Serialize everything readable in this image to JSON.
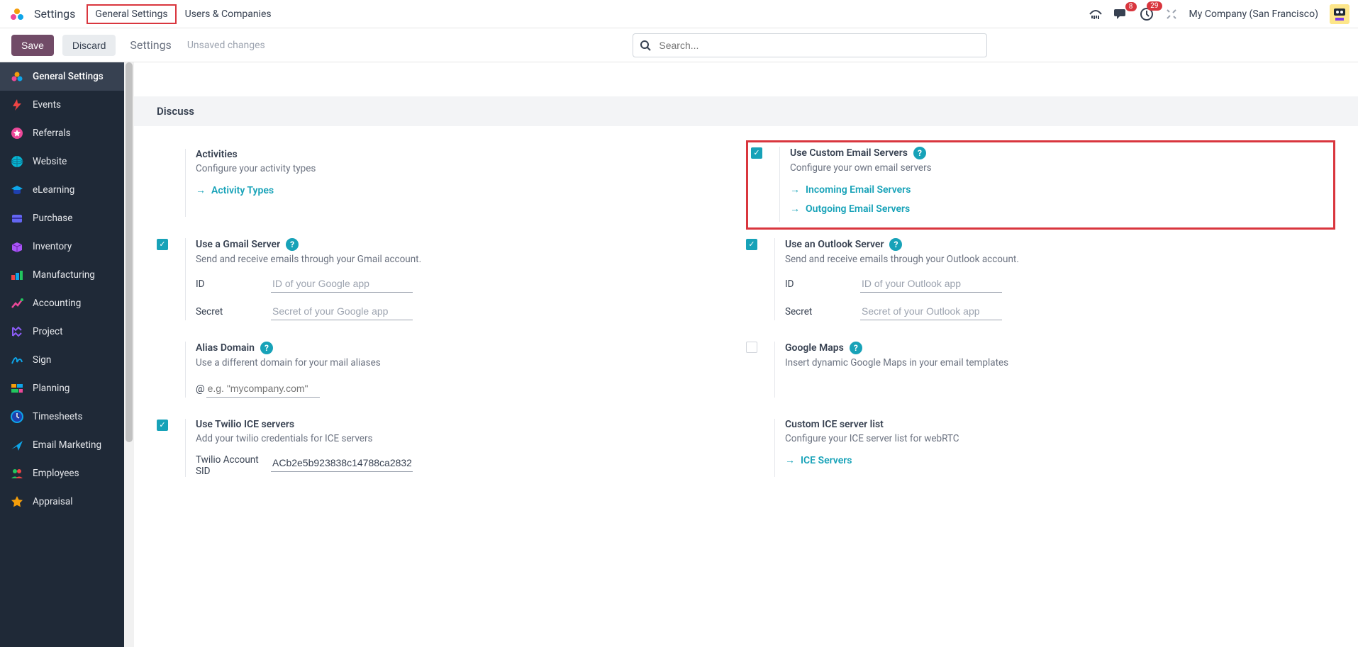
{
  "topnav": {
    "app_title": "Settings",
    "tab_general": "General Settings",
    "tab_users": "Users & Companies",
    "messages_badge": "8",
    "activities_badge": "29",
    "company_name": "My Company (San Francisco)"
  },
  "controlpanel": {
    "save": "Save",
    "discard": "Discard",
    "title": "Settings",
    "status": "Unsaved changes",
    "search_placeholder": "Search..."
  },
  "sidebar": {
    "items": [
      {
        "label": "General Settings"
      },
      {
        "label": "Events"
      },
      {
        "label": "Referrals"
      },
      {
        "label": "Website"
      },
      {
        "label": "eLearning"
      },
      {
        "label": "Purchase"
      },
      {
        "label": "Inventory"
      },
      {
        "label": "Manufacturing"
      },
      {
        "label": "Accounting"
      },
      {
        "label": "Project"
      },
      {
        "label": "Sign"
      },
      {
        "label": "Planning"
      },
      {
        "label": "Timesheets"
      },
      {
        "label": "Email Marketing"
      },
      {
        "label": "Employees"
      },
      {
        "label": "Appraisal"
      }
    ]
  },
  "settings": {
    "section_header": "Discuss",
    "activities": {
      "title": "Activities",
      "desc": "Configure your activity types",
      "link": "Activity Types"
    },
    "custom_email": {
      "title": "Use Custom Email Servers",
      "desc": "Configure your own email servers",
      "link_incoming": "Incoming Email Servers",
      "link_outgoing": "Outgoing Email Servers"
    },
    "gmail": {
      "title": "Use a Gmail Server",
      "desc": "Send and receive emails through your Gmail account.",
      "id_label": "ID",
      "id_placeholder": "ID of your Google app",
      "secret_label": "Secret",
      "secret_placeholder": "Secret of your Google app"
    },
    "outlook": {
      "title": "Use an Outlook Server",
      "desc": "Send and receive emails through your Outlook account.",
      "id_label": "ID",
      "id_placeholder": "ID of your Outlook app",
      "secret_label": "Secret",
      "secret_placeholder": "Secret of your Outlook app"
    },
    "alias": {
      "title": "Alias Domain",
      "desc": "Use a different domain for your mail aliases",
      "prefix": "@",
      "placeholder": "e.g. \"mycompany.com\""
    },
    "gmaps": {
      "title": "Google Maps",
      "desc": "Insert dynamic Google Maps in your email templates"
    },
    "twilio": {
      "title": "Use Twilio ICE servers",
      "desc": "Add your twilio credentials for ICE servers",
      "sid_label": "Twilio Account SID",
      "sid_value": "ACb2e5b923838c14788ca2832"
    },
    "ice": {
      "title": "Custom ICE server list",
      "desc": "Configure your ICE server list for webRTC",
      "link": "ICE Servers"
    }
  }
}
